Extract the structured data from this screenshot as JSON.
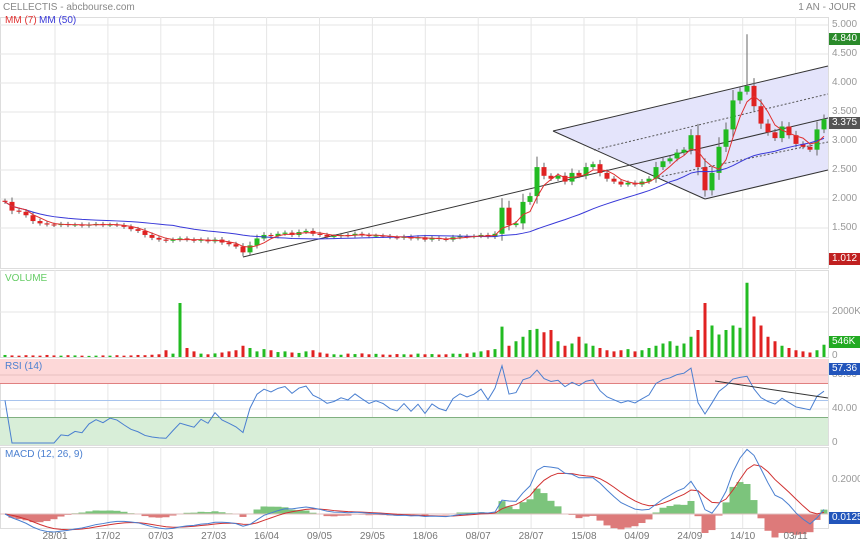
{
  "header": {
    "title": "CELLECTIS - abcbourse.com",
    "period": "1 AN - JOUR"
  },
  "legend": {
    "ma_short": "MM (7)",
    "ma_long": "MM (50)",
    "volume": "VOLUME",
    "rsi": "RSI (14)",
    "macd": "MACD (12, 26, 9)"
  },
  "colors": {
    "up": "#22bb22",
    "down": "#e02222",
    "ma_short": "#e03030",
    "ma_long": "#3838d8",
    "rsi_line": "#4a7fd0",
    "macd_line": "#4a7fd0",
    "signal_line": "#d03030",
    "channel_fill": "#e4e4fb"
  },
  "price_axis": {
    "ticks": [
      "5.000",
      "4.500",
      "4.000",
      "3.500",
      "3.000",
      "2.500",
      "2.000",
      "1.500"
    ],
    "high_label": "4.840",
    "last_label": "3.375",
    "low_label": "1.012"
  },
  "volume_axis": {
    "ticks": [
      "2000K",
      "0"
    ],
    "last_label": "546K"
  },
  "rsi_axis": {
    "ticks": [
      "80.00",
      "40.00",
      "0"
    ],
    "last_label": "57.36",
    "overbought": 70,
    "oversold": 30
  },
  "macd_axis": {
    "ticks": [
      "0.2000"
    ],
    "last_label": "0.0125"
  },
  "x_labels": [
    "28/01",
    "17/02",
    "07/03",
    "27/03",
    "16/04",
    "09/05",
    "29/05",
    "18/06",
    "08/07",
    "28/07",
    "15/08",
    "04/09",
    "24/09",
    "14/10",
    "03/11"
  ],
  "chart_data": {
    "type": "candlestick",
    "price_range": [
      0.9,
      5.1
    ],
    "closes": [
      1.95,
      1.8,
      1.78,
      1.72,
      1.62,
      1.58,
      1.56,
      1.55,
      1.57,
      1.55,
      1.56,
      1.54,
      1.56,
      1.57,
      1.55,
      1.56,
      1.55,
      1.52,
      1.48,
      1.45,
      1.38,
      1.33,
      1.3,
      1.28,
      1.3,
      1.32,
      1.3,
      1.28,
      1.3,
      1.27,
      1.3,
      1.25,
      1.22,
      1.18,
      1.08,
      1.2,
      1.32,
      1.38,
      1.36,
      1.4,
      1.42,
      1.38,
      1.43,
      1.45,
      1.4,
      1.38,
      1.35,
      1.36,
      1.38,
      1.37,
      1.4,
      1.38,
      1.36,
      1.37,
      1.36,
      1.34,
      1.33,
      1.35,
      1.32,
      1.34,
      1.3,
      1.33,
      1.31,
      1.3,
      1.34,
      1.36,
      1.35,
      1.36,
      1.38,
      1.35,
      1.4,
      1.85,
      1.55,
      1.58,
      1.95,
      2.05,
      2.55,
      2.4,
      2.35,
      2.4,
      2.3,
      2.45,
      2.4,
      2.55,
      2.6,
      2.45,
      2.35,
      2.3,
      2.25,
      2.28,
      2.25,
      2.3,
      2.35,
      2.55,
      2.65,
      2.7,
      2.8,
      2.85,
      3.1,
      2.55,
      2.15,
      2.45,
      2.9,
      3.2,
      3.7,
      3.85,
      3.95,
      3.6,
      3.3,
      3.15,
      3.05,
      3.25,
      3.1,
      2.95,
      2.9,
      2.85,
      3.2,
      3.375
    ],
    "volumes_k": [
      90,
      70,
      60,
      80,
      70,
      60,
      90,
      70,
      60,
      80,
      70,
      60,
      50,
      60,
      70,
      60,
      80,
      60,
      70,
      90,
      80,
      100,
      120,
      300,
      150,
      2400,
      400,
      250,
      150,
      120,
      160,
      200,
      250,
      300,
      500,
      400,
      250,
      350,
      300,
      220,
      250,
      200,
      180,
      250,
      300,
      200,
      150,
      120,
      100,
      150,
      130,
      160,
      120,
      140,
      110,
      100,
      130,
      120,
      110,
      150,
      120,
      130,
      110,
      120,
      150,
      140,
      160,
      200,
      250,
      300,
      350,
      1350,
      500,
      700,
      900,
      1200,
      1250,
      1100,
      1200,
      700,
      500,
      600,
      900,
      600,
      500,
      400,
      300,
      250,
      300,
      350,
      250,
      300,
      400,
      500,
      600,
      700,
      500,
      600,
      900,
      1200,
      2400,
      1400,
      1000,
      1200,
      1400,
      1300,
      3300,
      1800,
      1400,
      900,
      700,
      500,
      400,
      300,
      250,
      200,
      300,
      546
    ],
    "price_range_high": 4.84,
    "price_range_low": 1.012,
    "ma_periods": [
      7,
      50
    ],
    "rsi_period": 14,
    "macd_params": [
      12,
      26,
      9
    ]
  }
}
